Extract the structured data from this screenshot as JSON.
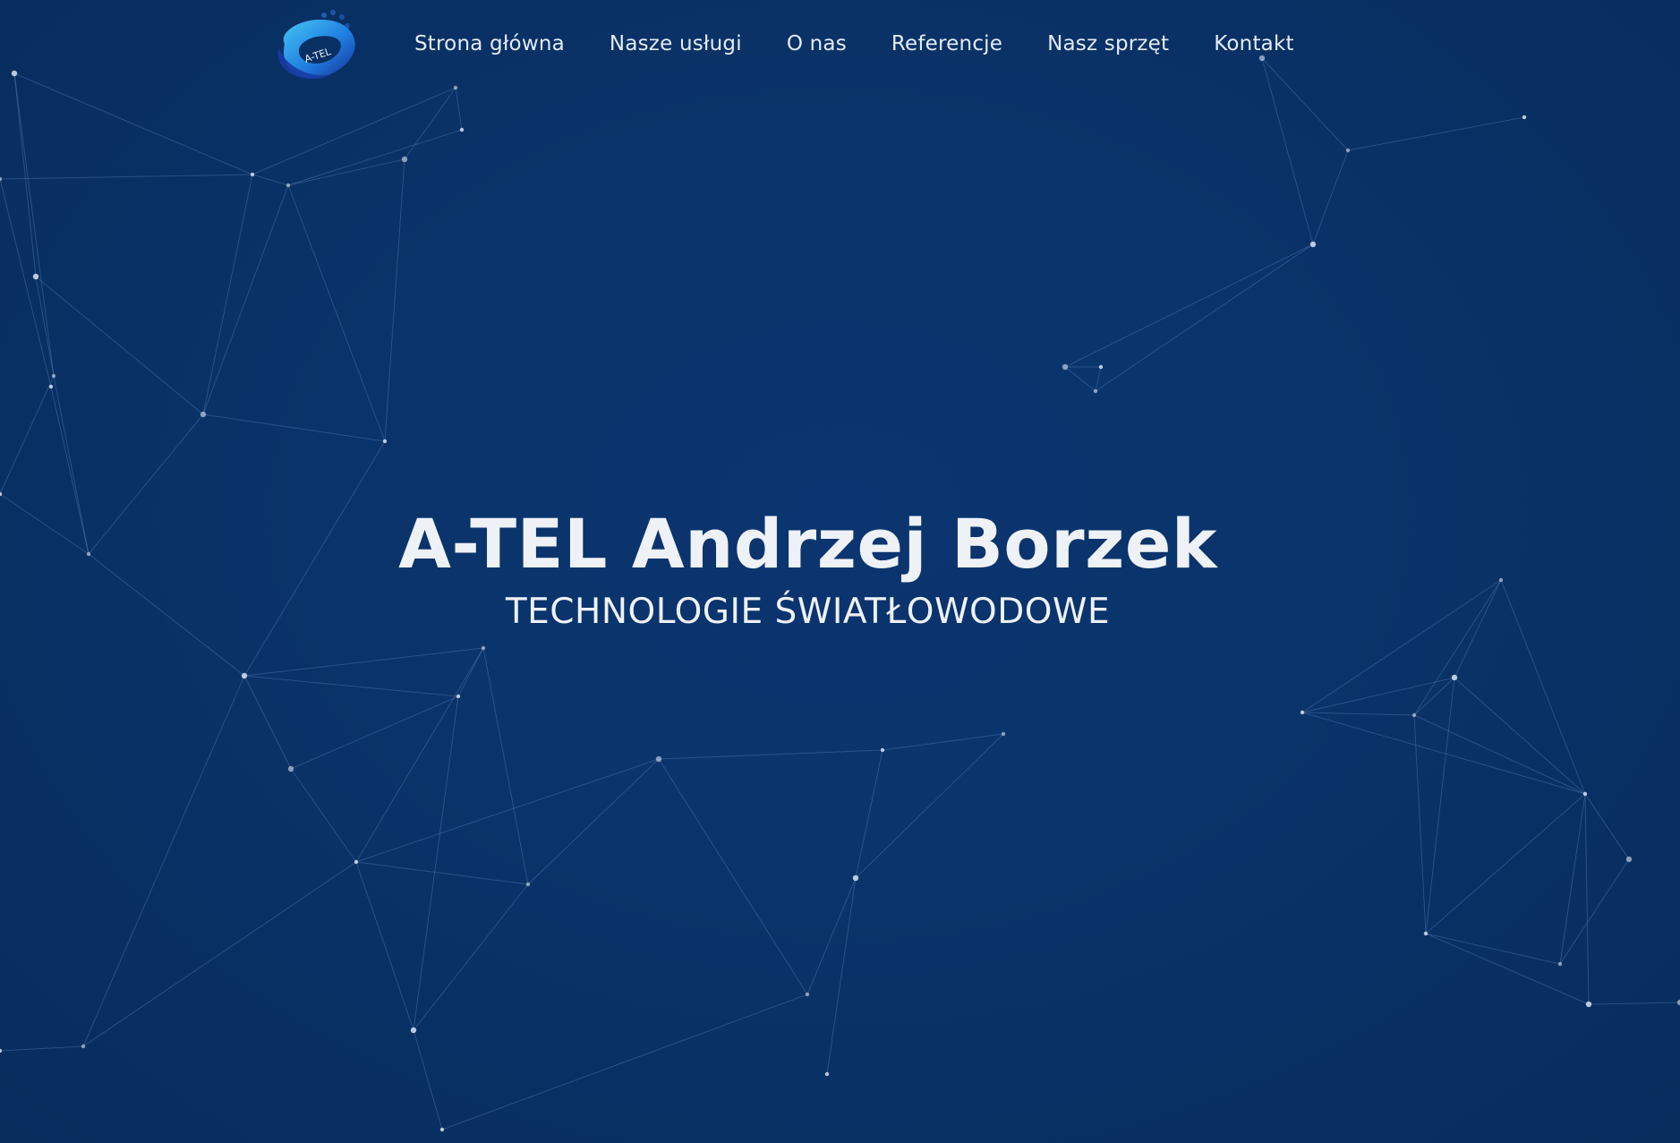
{
  "brand": {
    "logo_text": "A-TEL",
    "logo_icon": "ring-logo-icon"
  },
  "nav": {
    "items": [
      {
        "label": "Strona główna"
      },
      {
        "label": "Nasze usługi"
      },
      {
        "label": "O nas"
      },
      {
        "label": "Referencje"
      },
      {
        "label": "Nasz sprzęt"
      },
      {
        "label": "Kontakt"
      }
    ]
  },
  "hero": {
    "title": "A-TEL Andrzej Borzek",
    "subtitle": "TECHNOLOGIE ŚWIATŁOWODOWE"
  },
  "colors": {
    "background": "#0a3369",
    "text": "#eef1f6",
    "network_line": "#5f86bd",
    "network_node": "#d7e3f3",
    "logo_light": "#3fb6f2",
    "logo_dark": "#1b3fa8"
  }
}
